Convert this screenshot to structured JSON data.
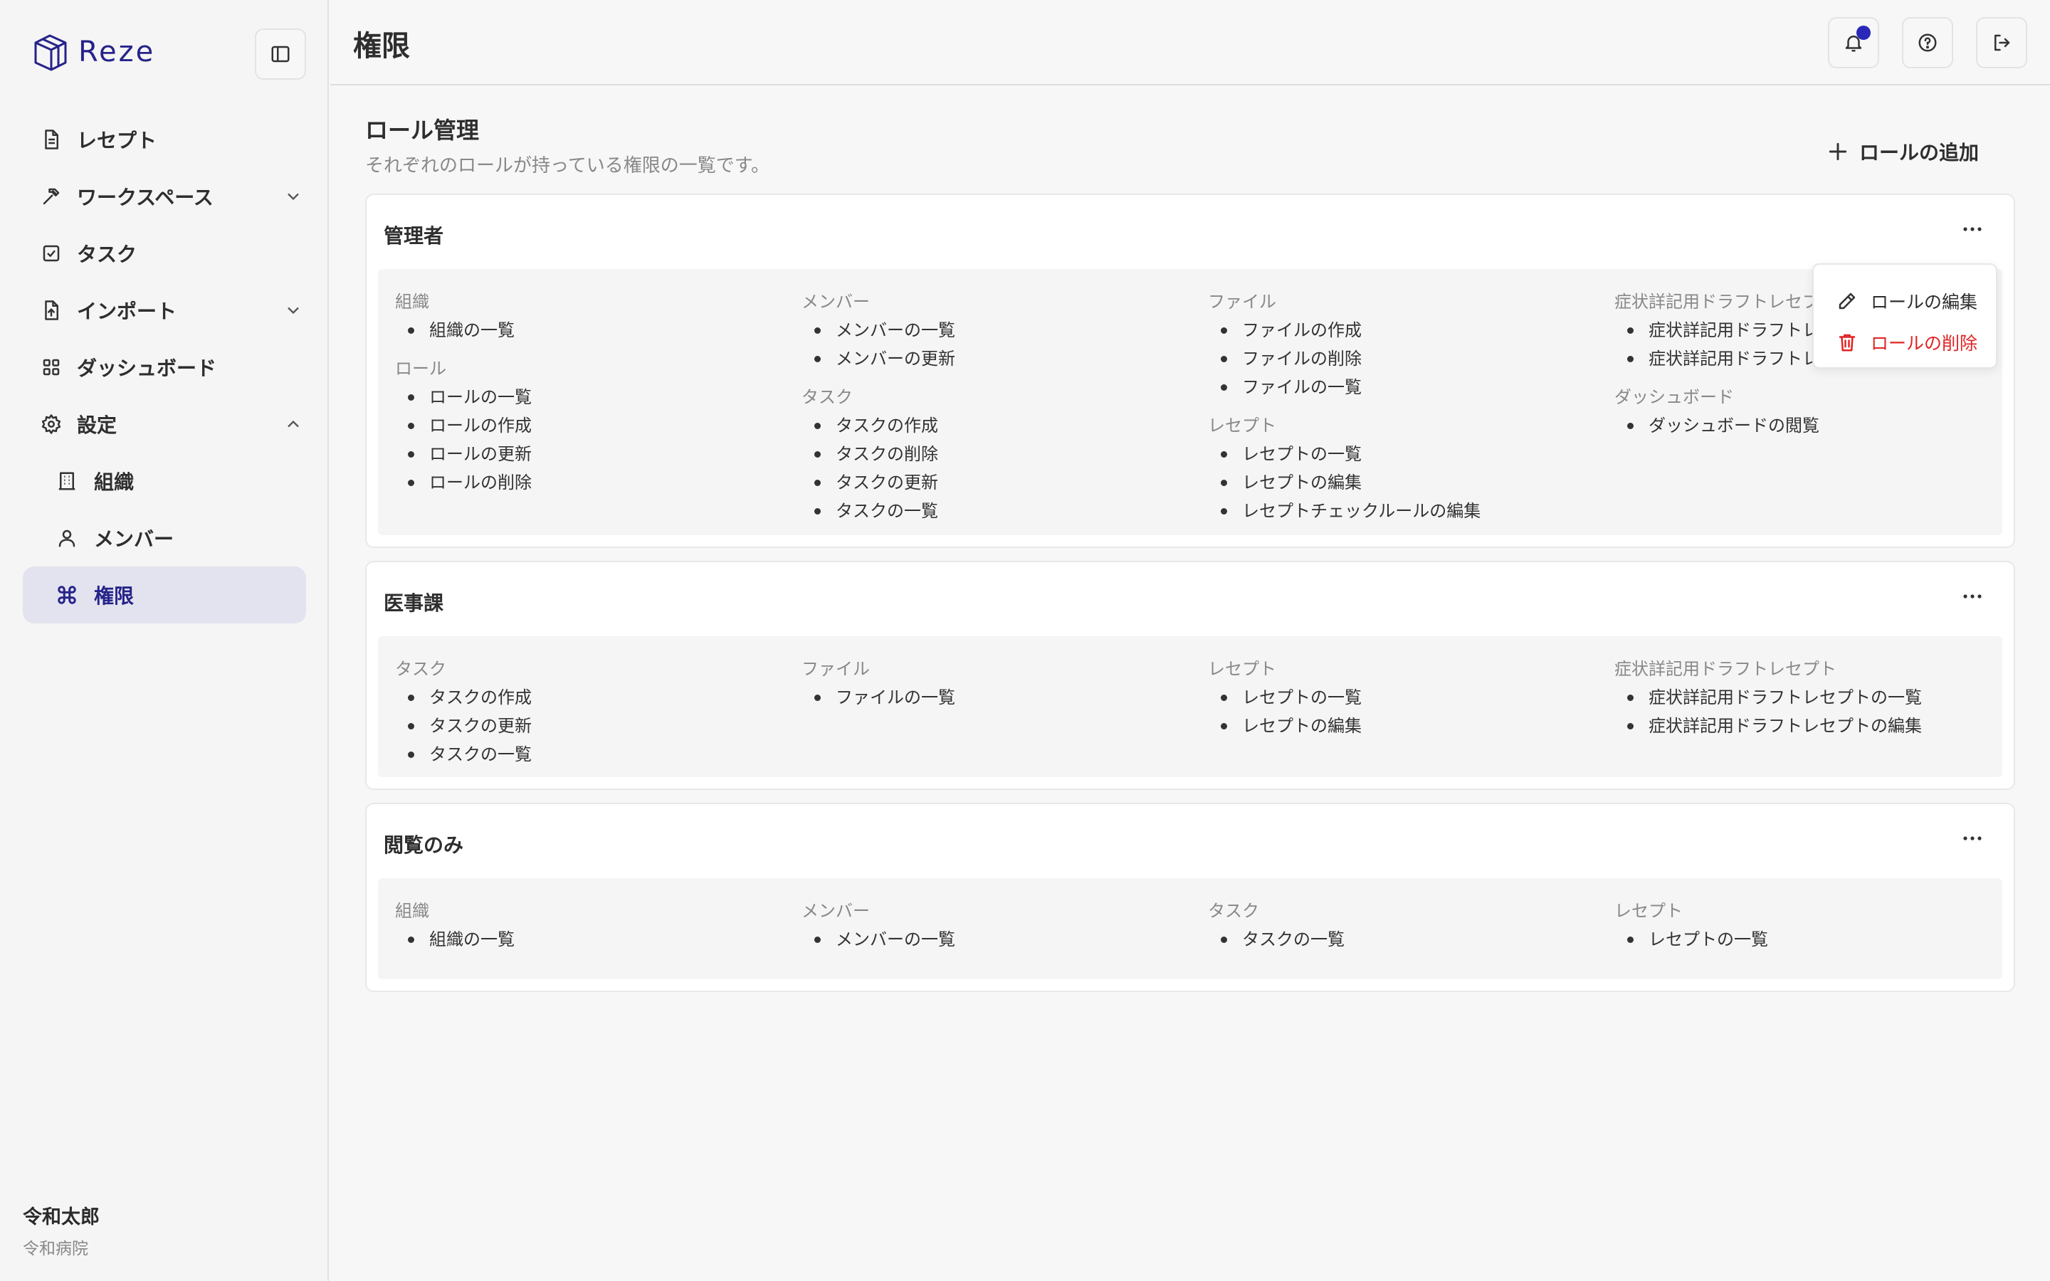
{
  "app": {
    "brand": "Reze"
  },
  "colors": {
    "brand": "#26238a",
    "danger": "#e02424",
    "notification": "#2a28b8",
    "active_bg": "#e3e3ef"
  },
  "sidebar": {
    "items": [
      {
        "label": "レセプト",
        "icon": "document-icon"
      },
      {
        "label": "ワークスペース",
        "icon": "hammer-icon",
        "expanded": false
      },
      {
        "label": "タスク",
        "icon": "checkbox-icon"
      },
      {
        "label": "インポート",
        "icon": "file-import-icon",
        "expanded": false
      },
      {
        "label": "ダッシュボード",
        "icon": "grid-icon"
      },
      {
        "label": "設定",
        "icon": "gear-icon",
        "expanded": true
      },
      {
        "label": "組織",
        "icon": "building-icon"
      },
      {
        "label": "メンバー",
        "icon": "user-icon"
      },
      {
        "label": "権限",
        "icon": "command-icon",
        "active": true
      }
    ]
  },
  "user": {
    "name": "令和太郎",
    "org": "令和病院"
  },
  "header": {
    "title": "権限"
  },
  "main": {
    "section_title": "ロール管理",
    "section_subtitle": "それぞれのロールが持っている権限の一覧です。",
    "add_role_label": "ロールの追加"
  },
  "dropdown": {
    "edit": "ロールの編集",
    "delete": "ロールの削除"
  },
  "roles": [
    {
      "name": "管理者",
      "columns": [
        [
          {
            "title": "組織",
            "perms": [
              "組織の一覧"
            ]
          },
          {
            "title": "ロール",
            "perms": [
              "ロールの一覧",
              "ロールの作成",
              "ロールの更新",
              "ロールの削除"
            ]
          }
        ],
        [
          {
            "title": "メンバー",
            "perms": [
              "メンバーの一覧",
              "メンバーの更新"
            ]
          },
          {
            "title": "タスク",
            "perms": [
              "タスクの作成",
              "タスクの削除",
              "タスクの更新",
              "タスクの一覧"
            ]
          }
        ],
        [
          {
            "title": "ファイル",
            "perms": [
              "ファイルの作成",
              "ファイルの削除",
              "ファイルの一覧"
            ]
          },
          {
            "title": "レセプト",
            "perms": [
              "レセプトの一覧",
              "レセプトの編集",
              "レセプトチェックルールの編集"
            ]
          }
        ],
        [
          {
            "title": "症状詳記用ドラフトレセプ",
            "perms": [
              "症状詳記用ドラフトレ",
              "症状詳記用ドラフトレ"
            ]
          },
          {
            "title": "ダッシュボード",
            "perms": [
              "ダッシュボードの閲覧"
            ]
          }
        ]
      ]
    },
    {
      "name": "医事課",
      "columns": [
        [
          {
            "title": "タスク",
            "perms": [
              "タスクの作成",
              "タスクの更新",
              "タスクの一覧"
            ]
          }
        ],
        [
          {
            "title": "ファイル",
            "perms": [
              "ファイルの一覧"
            ]
          }
        ],
        [
          {
            "title": "レセプト",
            "perms": [
              "レセプトの一覧",
              "レセプトの編集"
            ]
          }
        ],
        [
          {
            "title": "症状詳記用ドラフトレセプト",
            "perms": [
              "症状詳記用ドラフトレセプトの一覧",
              "症状詳記用ドラフトレセプトの編集"
            ]
          }
        ]
      ]
    },
    {
      "name": "閲覧のみ",
      "columns": [
        [
          {
            "title": "組織",
            "perms": [
              "組織の一覧"
            ]
          }
        ],
        [
          {
            "title": "メンバー",
            "perms": [
              "メンバーの一覧"
            ]
          }
        ],
        [
          {
            "title": "タスク",
            "perms": [
              "タスクの一覧"
            ]
          }
        ],
        [
          {
            "title": "レセプト",
            "perms": [
              "レセプトの一覧"
            ]
          }
        ]
      ]
    }
  ]
}
